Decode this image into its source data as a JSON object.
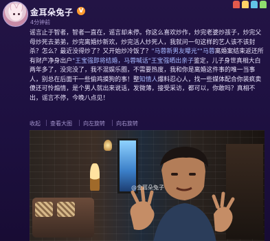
{
  "post": {
    "username": "金耳朵兔子",
    "verified_badge": "V",
    "timestamp": "4分钟前",
    "content_lines": [
      "谣言止于智者，智者一直在，谣言却未停。你这么喜欢炒作，炒完老婆炒孩子，",
      "炒完父母炒死去弟弟，炒完离婚炒新欢，炒完活人炒死人，我就问一句这样的艺",
      "人该不该封杀？怎么？最近没得炒了？又开始炒冷饭了？",
      "离婚案结束返还所有财产净身出户",
      "鉴定，儿子身世真相大白",
      "我和你是离婚这件事的唯一当事人，别总在后面干一些偷鸡摸狗的事！整",
      "爆料",
      "微薄，接受采访，都可以，你敢吗？真相不出，谣言不停，今晚八点见！"
    ],
    "inline_links": {
      "new_bf": "\"马蓉新男友曝光\"",
      "ma_rong_1": "\"马蓉",
      "wang_said": "\"王宝强即将结婚，马蓉喊话\"",
      "wbq_child": "王宝强晒出亲子",
      "zhishi": "知情人"
    },
    "content_fragments": {
      "l3_tail": "两年多了，没完没了，我不混娱乐圈，不需要热度，",
      "l5_mid": "忍心人，找一些媒体配合你装疯卖傻还可怜煽情，是个男人就出来说话，发"
    },
    "actions": {
      "collapse": "收起",
      "view_large": "查看大图",
      "rotate_left": "向左旋转",
      "rotate_right": "向右旋转"
    },
    "image": {
      "watermark": "@金耳朵兔子"
    }
  },
  "colors": {
    "background": "#1b0f3a",
    "text": "#e9e3fb",
    "link": "#a7b8ff",
    "badge": "#ff9a2e"
  },
  "icons": [
    "avatar",
    "verified-badge-icon",
    "decoration-icon"
  ]
}
